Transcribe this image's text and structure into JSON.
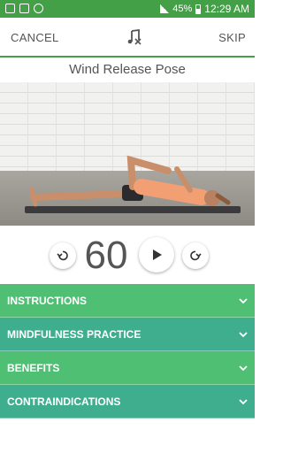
{
  "status_bar": {
    "battery": "45%",
    "time": "12:29 AM"
  },
  "top_bar": {
    "cancel_label": "CANCEL",
    "skip_label": "SKIP",
    "music_icon": "music-off-icon"
  },
  "pose": {
    "title": "Wind Release Pose"
  },
  "timer": {
    "seconds": "60"
  },
  "sections": [
    {
      "label": "INSTRUCTIONS",
      "color": "#4fbf74"
    },
    {
      "label": "MINDFULNESS PRACTICE",
      "color": "#3fae8f"
    },
    {
      "label": "BENEFITS",
      "color": "#4fbf74"
    },
    {
      "label": "CONTRAINDICATIONS",
      "color": "#3fae8f"
    }
  ],
  "colors": {
    "accent": "#43a047"
  }
}
